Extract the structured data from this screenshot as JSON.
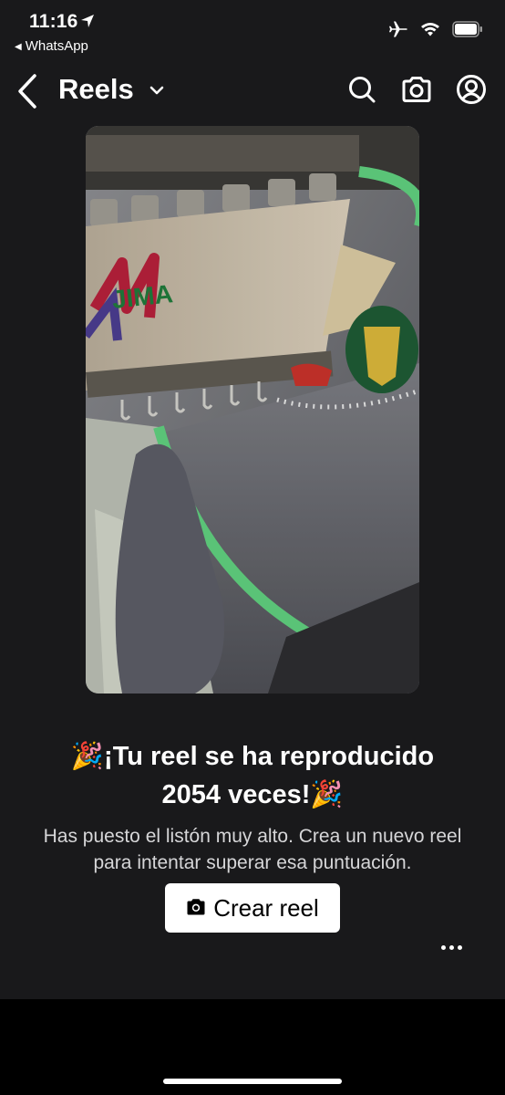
{
  "status_bar": {
    "time": "11:16",
    "back_app": "WhatsApp",
    "icons": [
      "location-arrow-icon",
      "airplane-icon",
      "wifi-icon",
      "battery-icon"
    ]
  },
  "nav": {
    "title": "Reels",
    "icons": [
      "back-chevron-icon",
      "chevron-down-icon",
      "search-icon",
      "camera-icon",
      "profile-icon"
    ]
  },
  "message": {
    "headline_line1": "🎉¡Tu reel se ha reproducido",
    "headline_line2": "2054 veces!🎉",
    "subtext": "Has puesto el listón muy alto. Crea un nuevo reel para intentar superar esa puntuación."
  },
  "actions": {
    "create_reel": "Crear reel",
    "more_icon": "more-horizontal-icon"
  },
  "video": {
    "logo_text": "JIMA"
  },
  "colors": {
    "background": "#19191b",
    "button_bg": "#ffffff",
    "accent_green": "#5fce7e"
  }
}
